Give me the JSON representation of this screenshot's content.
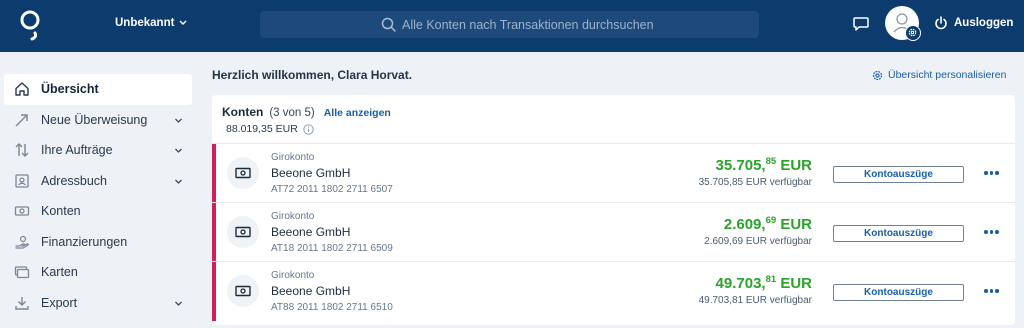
{
  "header": {
    "user_selector": "Unbekannt",
    "search_placeholder": "Alle Konten nach Transaktionen durchsuchen",
    "logout_label": "Ausloggen"
  },
  "sidebar": {
    "items": [
      {
        "label": "Übersicht",
        "icon": "home-icon",
        "active": true,
        "expandable": false
      },
      {
        "label": "Neue Überweisung",
        "icon": "transfer-arrow-icon",
        "active": false,
        "expandable": true
      },
      {
        "label": "Ihre Aufträge",
        "icon": "orders-arrows-icon",
        "active": false,
        "expandable": true
      },
      {
        "label": "Adressbuch",
        "icon": "address-book-icon",
        "active": false,
        "expandable": true
      },
      {
        "label": "Konten",
        "icon": "banknote-icon",
        "active": false,
        "expandable": false
      },
      {
        "label": "Finanzierungen",
        "icon": "financing-icon",
        "active": false,
        "expandable": false
      },
      {
        "label": "Karten",
        "icon": "cards-icon",
        "active": false,
        "expandable": false
      },
      {
        "label": "Export",
        "icon": "download-icon",
        "active": false,
        "expandable": true
      }
    ]
  },
  "main": {
    "welcome": "Herzlich willkommen, Clara Horvat.",
    "personalize_label": "Übersicht personalisieren",
    "accounts": {
      "title": "Konten",
      "count": "(3 von 5)",
      "show_all": "Alle anzeigen",
      "total": "88.019,35 EUR",
      "rows": [
        {
          "type": "Girokonto",
          "name": "Beeone GmbH",
          "iban": "AT72 2011 1802 2711 6507",
          "amount_int": "35.705,",
          "amount_dec": "85",
          "currency": " EUR",
          "available": "35.705,85 EUR verfügbar",
          "button": "Kontoauszüge"
        },
        {
          "type": "Girokonto",
          "name": "Beeone GmbH",
          "iban": "AT18 2011 1802 2711 6509",
          "amount_int": "2.609,",
          "amount_dec": "69",
          "currency": " EUR",
          "available": "2.609,69 EUR verfügbar",
          "button": "Kontoauszüge"
        },
        {
          "type": "Girokonto",
          "name": "Beeone GmbH",
          "iban": "AT88 2011 1802 2711 6510",
          "amount_int": "49.703,",
          "amount_dec": "81",
          "currency": " EUR",
          "available": "49.703,81 EUR verfügbar",
          "button": "Kontoauszüge"
        }
      ]
    }
  },
  "colors": {
    "topbar": "#0c3b6e",
    "accent_link": "#1a5fa8",
    "amount_green": "#29a329",
    "account_stripe": "#d0205a"
  }
}
